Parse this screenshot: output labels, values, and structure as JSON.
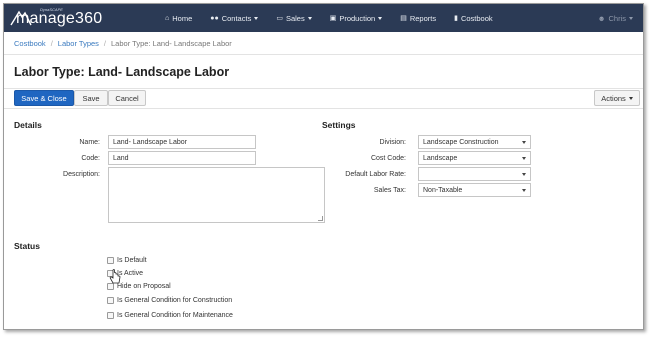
{
  "navbar": {
    "brand_small": "DynaSCAPE",
    "brand_name": "manage360",
    "items": [
      {
        "label": "Home",
        "icon": "home-icon",
        "has_caret": false
      },
      {
        "label": "Contacts",
        "icon": "users-icon",
        "has_caret": true
      },
      {
        "label": "Sales",
        "icon": "dollar-icon",
        "has_caret": true
      },
      {
        "label": "Production",
        "icon": "truck-icon",
        "has_caret": true
      },
      {
        "label": "Reports",
        "icon": "reports-icon",
        "has_caret": false
      },
      {
        "label": "Costbook",
        "icon": "book-icon",
        "has_caret": false
      }
    ],
    "user": "Chris"
  },
  "breadcrumb": {
    "items": [
      "Costbook",
      "Labor Types",
      "Labor Type: Land- Landscape Labor"
    ]
  },
  "page": {
    "title": "Labor Type: Land- Landscape Labor"
  },
  "toolbar": {
    "save_close_label": "Save & Close",
    "save_label": "Save",
    "cancel_label": "Cancel",
    "actions_label": "Actions"
  },
  "details": {
    "heading": "Details",
    "name_label": "Name:",
    "name_value": "Land- Landscape Labor",
    "code_label": "Code:",
    "code_value": "Land",
    "description_label": "Description:",
    "description_value": ""
  },
  "settings": {
    "heading": "Settings",
    "division_label": "Division:",
    "division_value": "Landscape Construction",
    "cost_code_label": "Cost Code:",
    "cost_code_value": "Landscape",
    "labor_rate_label": "Default Labor Rate:",
    "labor_rate_value": "",
    "sales_tax_label": "Sales Tax:",
    "sales_tax_value": "Non-Taxable"
  },
  "status": {
    "heading": "Status",
    "is_default": "Is Default",
    "is_active": "Is Active",
    "hide_on_proposal": "Hide on Proposal",
    "general_construction": "Is General Condition for Construction",
    "general_maintenance": "Is General Condition for Maintenance"
  },
  "colors": {
    "navbar_bg": "#2b3a55",
    "primary": "#1f66c1",
    "link": "#3a7abf"
  }
}
